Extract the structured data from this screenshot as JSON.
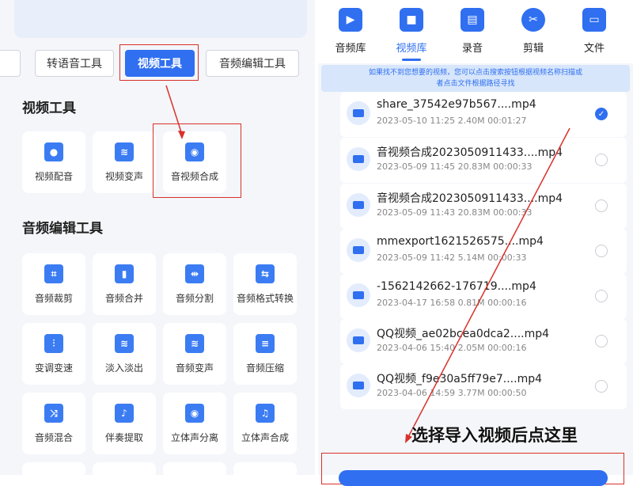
{
  "left": {
    "tabs": [
      "转语音工具",
      "视频工具",
      "音频编辑工具"
    ],
    "active_tab": "视频工具",
    "video_section_title": "视频工具",
    "video_tools": [
      {
        "label": "视频配音",
        "icon": "microphone-icon"
      },
      {
        "label": "视频变声",
        "icon": "film-waveform-icon"
      },
      {
        "label": "音视频合成",
        "icon": "video-merge-icon"
      }
    ],
    "audio_section_title": "音频编辑工具",
    "audio_tools": [
      {
        "label": "音频裁剪",
        "icon": "crop-icon"
      },
      {
        "label": "音频合并",
        "icon": "merge-icon"
      },
      {
        "label": "音频分割",
        "icon": "split-icon"
      },
      {
        "label": "音频格式转换",
        "icon": "convert-icon"
      },
      {
        "label": "变调变速",
        "icon": "equalizer-icon"
      },
      {
        "label": "淡入淡出",
        "icon": "fade-icon"
      },
      {
        "label": "音频变声",
        "icon": "voice-change-icon"
      },
      {
        "label": "音频压缩",
        "icon": "compress-icon"
      },
      {
        "label": "音频混合",
        "icon": "shuffle-icon"
      },
      {
        "label": "伴奏提取",
        "icon": "music-note-icon"
      },
      {
        "label": "立体声分离",
        "icon": "stereo-split-icon"
      },
      {
        "label": "立体声合成",
        "icon": "stereo-merge-icon"
      }
    ]
  },
  "right": {
    "tabs": [
      {
        "label": "音频库",
        "icon": "play-icon"
      },
      {
        "label": "视频库",
        "icon": "video-camera-icon"
      },
      {
        "label": "录音",
        "icon": "radio-icon"
      },
      {
        "label": "剪辑",
        "icon": "scissors-icon"
      },
      {
        "label": "文件",
        "icon": "folder-icon"
      }
    ],
    "active_tab": "视频库",
    "hint_line1": "如果找不到您想要的视频，您可以点击搜索按钮根据视频名称扫描或",
    "hint_line2": "者点击文件根据路径寻找",
    "files": [
      {
        "name": "share_37542e97b567....mp4",
        "meta": "2023-05-10 11:25   2.40M   00:01:27",
        "checked": true
      },
      {
        "name": "音视频合成2023050911433....mp4",
        "meta": "2023-05-09 11:45   20.83M   00:00:33",
        "checked": false
      },
      {
        "name": "音视频合成2023050911433....mp4",
        "meta": "2023-05-09 11:43   20.83M   00:00:33",
        "checked": false
      },
      {
        "name": "mmexport1621526575....mp4",
        "meta": "2023-05-09 11:42   5.14M   00:00:33",
        "checked": false
      },
      {
        "name": "-1562142662-176719....mp4",
        "meta": "2023-04-17 16:58   0.81M   00:00:16",
        "checked": false
      },
      {
        "name": "QQ视频_ae02bcea0dca2....mp4",
        "meta": "2023-04-06 15:40   2.05M   00:00:16",
        "checked": false
      },
      {
        "name": "QQ视频_f9e30a5ff79e7....mp4",
        "meta": "2023-04-06 14:59   3.77M   00:00:50",
        "checked": false
      }
    ],
    "annotation": "选择导入视频后点这里"
  }
}
